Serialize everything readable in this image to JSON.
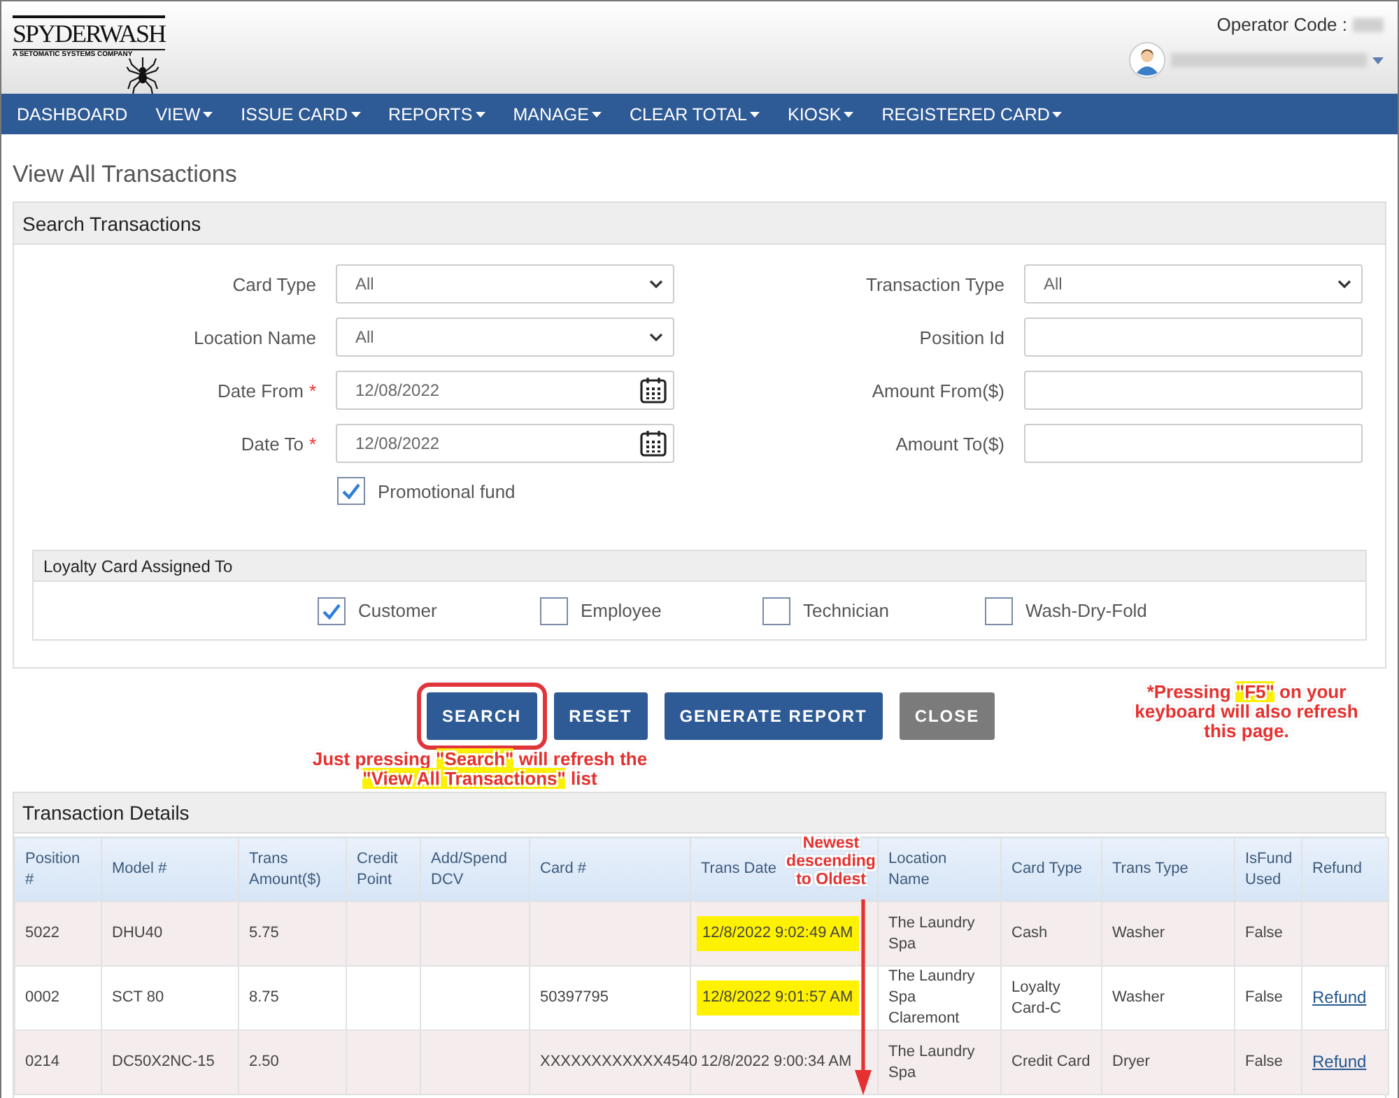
{
  "header": {
    "logo_name": "SPYDERWASH",
    "logo_tagline": "A SETOMATIC SYSTEMS COMPANY",
    "operator_label": "Operator Code :"
  },
  "nav": [
    {
      "label": "DASHBOARD",
      "dropdown": false
    },
    {
      "label": "VIEW",
      "dropdown": true
    },
    {
      "label": "ISSUE CARD",
      "dropdown": true
    },
    {
      "label": "REPORTS",
      "dropdown": true
    },
    {
      "label": "MANAGE",
      "dropdown": true
    },
    {
      "label": "CLEAR TOTAL",
      "dropdown": true
    },
    {
      "label": "KIOSK",
      "dropdown": true
    },
    {
      "label": "REGISTERED CARD",
      "dropdown": true
    }
  ],
  "page_title": "View All Transactions",
  "search_panel": {
    "title": "Search Transactions",
    "fields": [
      {
        "label": "Card Type",
        "kind": "select",
        "value": "All"
      },
      {
        "label": "Transaction Type",
        "kind": "select",
        "value": "All"
      },
      {
        "label": "Location Name",
        "kind": "select",
        "value": "All"
      },
      {
        "label": "Position Id",
        "kind": "text"
      },
      {
        "label": "Date From",
        "kind": "date",
        "value": "12/08/2022",
        "required_mark": "*"
      },
      {
        "label": "Amount From($)",
        "kind": "text"
      },
      {
        "label": "Date To",
        "kind": "date",
        "value": "12/08/2022",
        "required_mark": "*"
      },
      {
        "label": "Amount To($)",
        "kind": "text"
      }
    ],
    "promotional": {
      "label": "Promotional fund",
      "checked": true
    },
    "loyalty": {
      "title": "Loyalty Card Assigned To",
      "options": [
        {
          "label": "Customer",
          "checked": true
        },
        {
          "label": "Employee",
          "checked": false
        },
        {
          "label": "Technician",
          "checked": false
        },
        {
          "label": "Wash-Dry-Fold",
          "checked": false
        }
      ]
    }
  },
  "buttons": [
    {
      "label": "SEARCH",
      "kind": "primary",
      "circled": true
    },
    {
      "label": "RESET",
      "kind": "primary",
      "circled": false
    },
    {
      "label": "GENERATE REPORT",
      "kind": "primary",
      "circled": false
    },
    {
      "label": "CLOSE",
      "kind": "secondary",
      "circled": false
    }
  ],
  "notes": {
    "search": "Just pressing **\"Search\"** will refresh the **\"View All Transactions\"** list",
    "f5": "*Pressing **\"F5\"** on your keyboard will also refresh this page.",
    "sort": "Newest descending to Oldest"
  },
  "details": {
    "title": "Transaction Details",
    "columns": [
      {
        "label": "Position #",
        "kind": "text"
      },
      {
        "label": "Model #",
        "kind": "text"
      },
      {
        "label": "Trans Amount($)",
        "kind": "text"
      },
      {
        "label": "Credit Point",
        "kind": "text"
      },
      {
        "label": "Add/Spend DCV",
        "kind": "text"
      },
      {
        "label": "Card #",
        "kind": "text"
      },
      {
        "label": "Trans Date",
        "kind": "date"
      },
      {
        "label": "Location Name",
        "kind": "text"
      },
      {
        "label": "Card Type",
        "kind": "text"
      },
      {
        "label": "Trans Type",
        "kind": "text"
      },
      {
        "label": "IsFund Used",
        "kind": "text"
      },
      {
        "label": "Refund",
        "kind": "link"
      }
    ],
    "rows": [
      {
        "date_highlighted": true,
        "cells": [
          "5022",
          "DHU40",
          "5.75",
          null,
          null,
          null,
          "12/8/2022 9:02:49 AM",
          "The Laundry Spa",
          "Cash",
          "Washer",
          "False",
          null
        ]
      },
      {
        "date_highlighted": true,
        "cells": [
          "0002",
          "SCT 80",
          "8.75",
          null,
          null,
          "50397795",
          "12/8/2022 9:01:57 AM",
          "The Laundry Spa Claremont",
          "Loyalty Card-C",
          "Washer",
          "False",
          "Refund"
        ]
      },
      {
        "date_highlighted": false,
        "cells": [
          "0214",
          "DC50X2NC-15",
          "2.50",
          null,
          null,
          "XXXXXXXXXXXX4540",
          "12/8/2022 9:00:34 AM",
          "The Laundry Spa",
          "Credit Card",
          "Dryer",
          "False",
          "Refund"
        ]
      }
    ]
  }
}
